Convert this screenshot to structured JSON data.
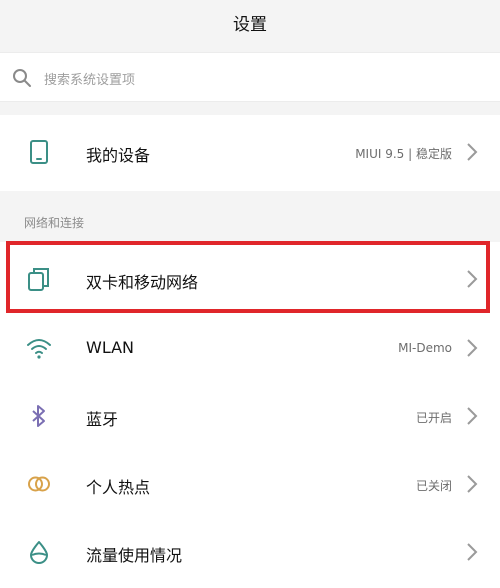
{
  "header": {
    "title": "设置"
  },
  "search": {
    "placeholder": "搜索系统设置项"
  },
  "device": {
    "label": "我的设备",
    "value": "MIUI 9.5 | 稳定版"
  },
  "section": {
    "network_title": "网络和连接"
  },
  "items": [
    {
      "label": "双卡和移动网络",
      "value": ""
    },
    {
      "label": "WLAN",
      "value": "MI-Demo"
    },
    {
      "label": "蓝牙",
      "value": "已开启"
    },
    {
      "label": "个人热点",
      "value": "已关闭"
    },
    {
      "label": "流量使用情况",
      "value": ""
    }
  ],
  "colors": {
    "accent_teal": "#3b8f86",
    "bluetooth_purple": "#7b6fb3",
    "hotspot_orange": "#d8a24a",
    "highlight_red": "#e0262a"
  },
  "icons": {
    "device": "phone-icon",
    "sim": "dual-sim-icon",
    "wlan": "wifi-icon",
    "bluetooth": "bluetooth-icon",
    "hotspot": "hotspot-icon",
    "data": "data-usage-icon"
  }
}
